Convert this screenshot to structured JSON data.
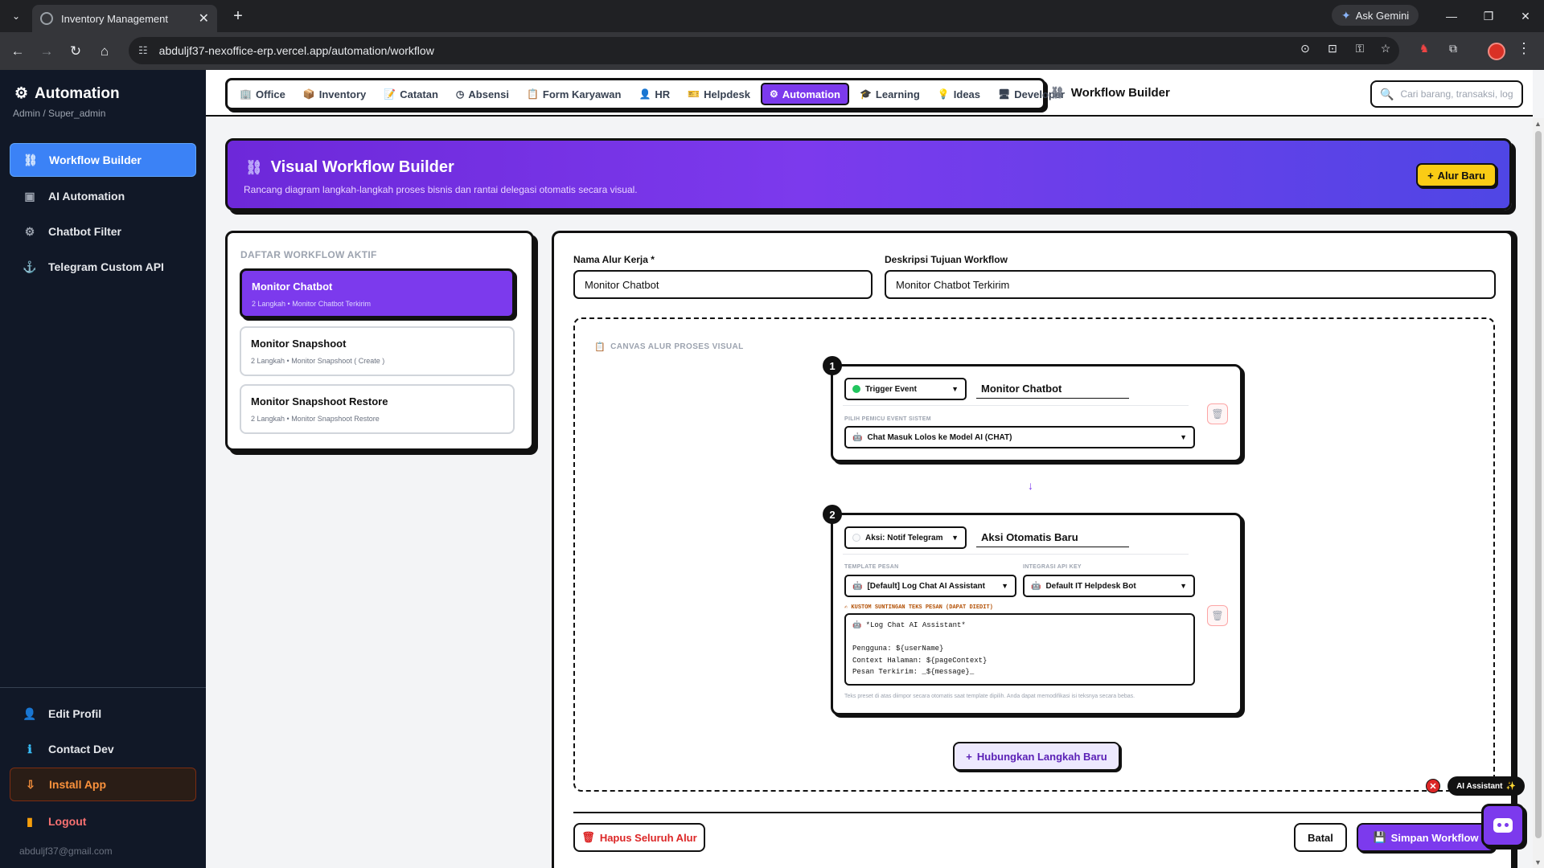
{
  "browser": {
    "tab_title": "Inventory Management",
    "url": "abduljf37-nexoffice-erp.vercel.app/automation/workflow",
    "ask_gemini": "Ask Gemini"
  },
  "sidebar": {
    "brand": "Automation",
    "subtitle": "Admin / Super_admin",
    "items": [
      {
        "label": "Workflow Builder",
        "icon": "workflow-icon"
      },
      {
        "label": "AI Automation",
        "icon": "robot-icon"
      },
      {
        "label": "Chatbot Filter",
        "icon": "gear-icon"
      },
      {
        "label": "Telegram Custom API",
        "icon": "anchor-icon"
      }
    ],
    "bottom": [
      {
        "label": "Edit Profil",
        "icon": "user-icon"
      },
      {
        "label": "Contact Dev",
        "icon": "info-icon"
      },
      {
        "label": "Install App",
        "icon": "install-icon"
      },
      {
        "label": "Logout",
        "icon": "door-icon"
      }
    ],
    "email": "abduljf37@gmail.com"
  },
  "topnav": {
    "items": [
      "Office",
      "Inventory",
      "Catatan",
      "Absensi",
      "Form Karyawan",
      "HR",
      "Helpdesk",
      "Automation",
      "Learning",
      "Ideas",
      "Developer"
    ],
    "active": "Automation",
    "page_title": "Workflow Builder",
    "search_placeholder": "Cari barang, transaksi, log..."
  },
  "banner": {
    "title": "Visual Workflow Builder",
    "subtitle": "Rancang diagram langkah-langkah proses bisnis dan rantai delegasi otomatis secara visual.",
    "new_button": "Alur Baru"
  },
  "workflow_list": {
    "title": "DAFTAR WORKFLOW AKTIF",
    "items": [
      {
        "name": "Monitor Chatbot",
        "desc": "2 Langkah • Monitor Chatbot Terkirim"
      },
      {
        "name": "Monitor Snapshoot",
        "desc": "2 Langkah • Monitor Snapshoot ( Create )"
      },
      {
        "name": "Monitor Snapshoot Restore",
        "desc": "2 Langkah • Monitor Snapshoot Restore"
      }
    ]
  },
  "editor": {
    "name_label": "Nama Alur Kerja *",
    "name_value": "Monitor Chatbot",
    "desc_label": "Deskripsi Tujuan Workflow",
    "desc_value": "Monitor Chatbot Terkirim",
    "canvas_title": "CANVAS ALUR PROSES VISUAL",
    "step1": {
      "number": "1",
      "type": "Trigger Event",
      "name": "Monitor Chatbot",
      "event_label": "PILIH PEMICU EVENT SISTEM",
      "event_value": "Chat Masuk Lolos ke Model AI (CHAT)"
    },
    "arrow": "↓",
    "step2": {
      "number": "2",
      "type": "Aksi: Notif Telegram",
      "name": "Aksi Otomatis Baru",
      "template_label": "TEMPLATE PESAN",
      "template_value": "[Default] Log Chat AI Assistant",
      "api_label": "INTEGRASI API KEY",
      "api_value": "Default IT Helpdesk Bot",
      "custom_label": "KUSTOM SUNTINGAN TEKS PESAN (DAPAT DIEDIT)",
      "message_lines": [
        "🤖 *Log Chat AI Assistant*",
        "",
        "Pengguna: ${userName}",
        "Context Halaman: ${pageContext}",
        "Pesan Terkirim: _${message}_"
      ],
      "helper": "Teks preset di atas diimpor secara otomatis saat template dipilih. Anda dapat memodifikasi isi teksnya secara bebas."
    },
    "connect_button": "Hubungkan Langkah Baru",
    "delete_button": "Hapus Seluruh Alur",
    "cancel_button": "Batal",
    "save_button": "Simpan Workflow"
  },
  "ai_assistant": {
    "label": "AI Assistant"
  },
  "colors": {
    "accent": "#7c3aed",
    "sidebar_bg": "#111827",
    "active_blue": "#3b82f6",
    "yellow": "#facc15",
    "danger": "#dc2626"
  }
}
